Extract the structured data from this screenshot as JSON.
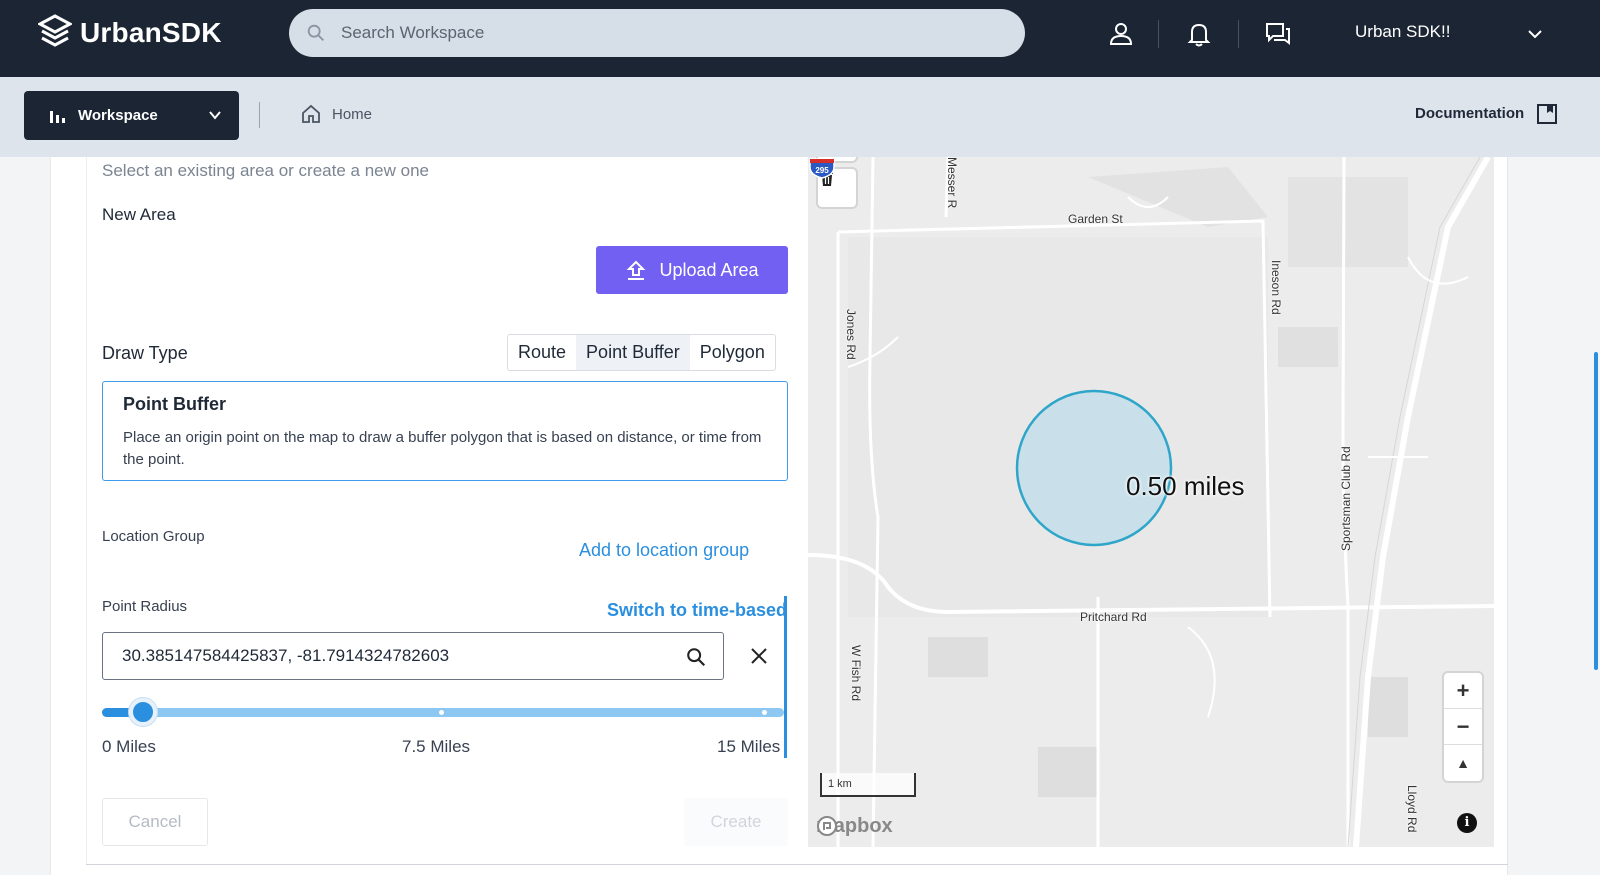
{
  "header": {
    "logo_text": "UrbanSDK",
    "search_placeholder": "Search Workspace",
    "account_name": "Urban SDK!!"
  },
  "subnav": {
    "workspace_label": "Workspace",
    "home_label": "Home",
    "documentation_label": "Documentation"
  },
  "form": {
    "hint": "Select an existing area or create a new one",
    "new_area_label": "New Area",
    "upload_label": "Upload Area",
    "draw_type_label": "Draw Type",
    "draw_types": [
      "Route",
      "Point Buffer",
      "Polygon"
    ],
    "selected_draw_type": "Point Buffer",
    "info_title": "Point Buffer",
    "info_description": "Place an origin point on the map to draw a buffer polygon that is based on distance, or time from the point.",
    "location_group_label": "Location Group",
    "add_location_group": "Add to location group",
    "point_radius_label": "Point Radius",
    "switch_time_based": "Switch to time-based",
    "coordinates_value": "30.385147584425837, -81.7914324782603",
    "slider": {
      "min_label": "0 Miles",
      "mid_label": "7.5 Miles",
      "max_label": "15 Miles",
      "min": 0,
      "max": 15,
      "value": 0.5
    },
    "cancel_label": "Cancel",
    "create_label": "Create"
  },
  "map": {
    "radius_label": "0.50 miles",
    "roads": {
      "garden": "Garden St",
      "messer": "Messer R",
      "jones": "Jones Rd",
      "ineson": "Ineson Rd",
      "sportsman": "Sportsman Club Rd",
      "pritchard": "Pritchard Rd",
      "wfish": "W Fish Rd",
      "lloyd": "Lloyd Rd"
    },
    "interstate": "295",
    "scale_label": "1 km",
    "attribution": "mapbox",
    "zoom_in": "+",
    "zoom_out": "−",
    "compass": "▲",
    "info": "i"
  },
  "colors": {
    "header_bg": "#1b2533",
    "accent_purple": "#7160f2",
    "link_blue": "#2b8fe0",
    "buffer_stroke": "#2fa6c9"
  }
}
